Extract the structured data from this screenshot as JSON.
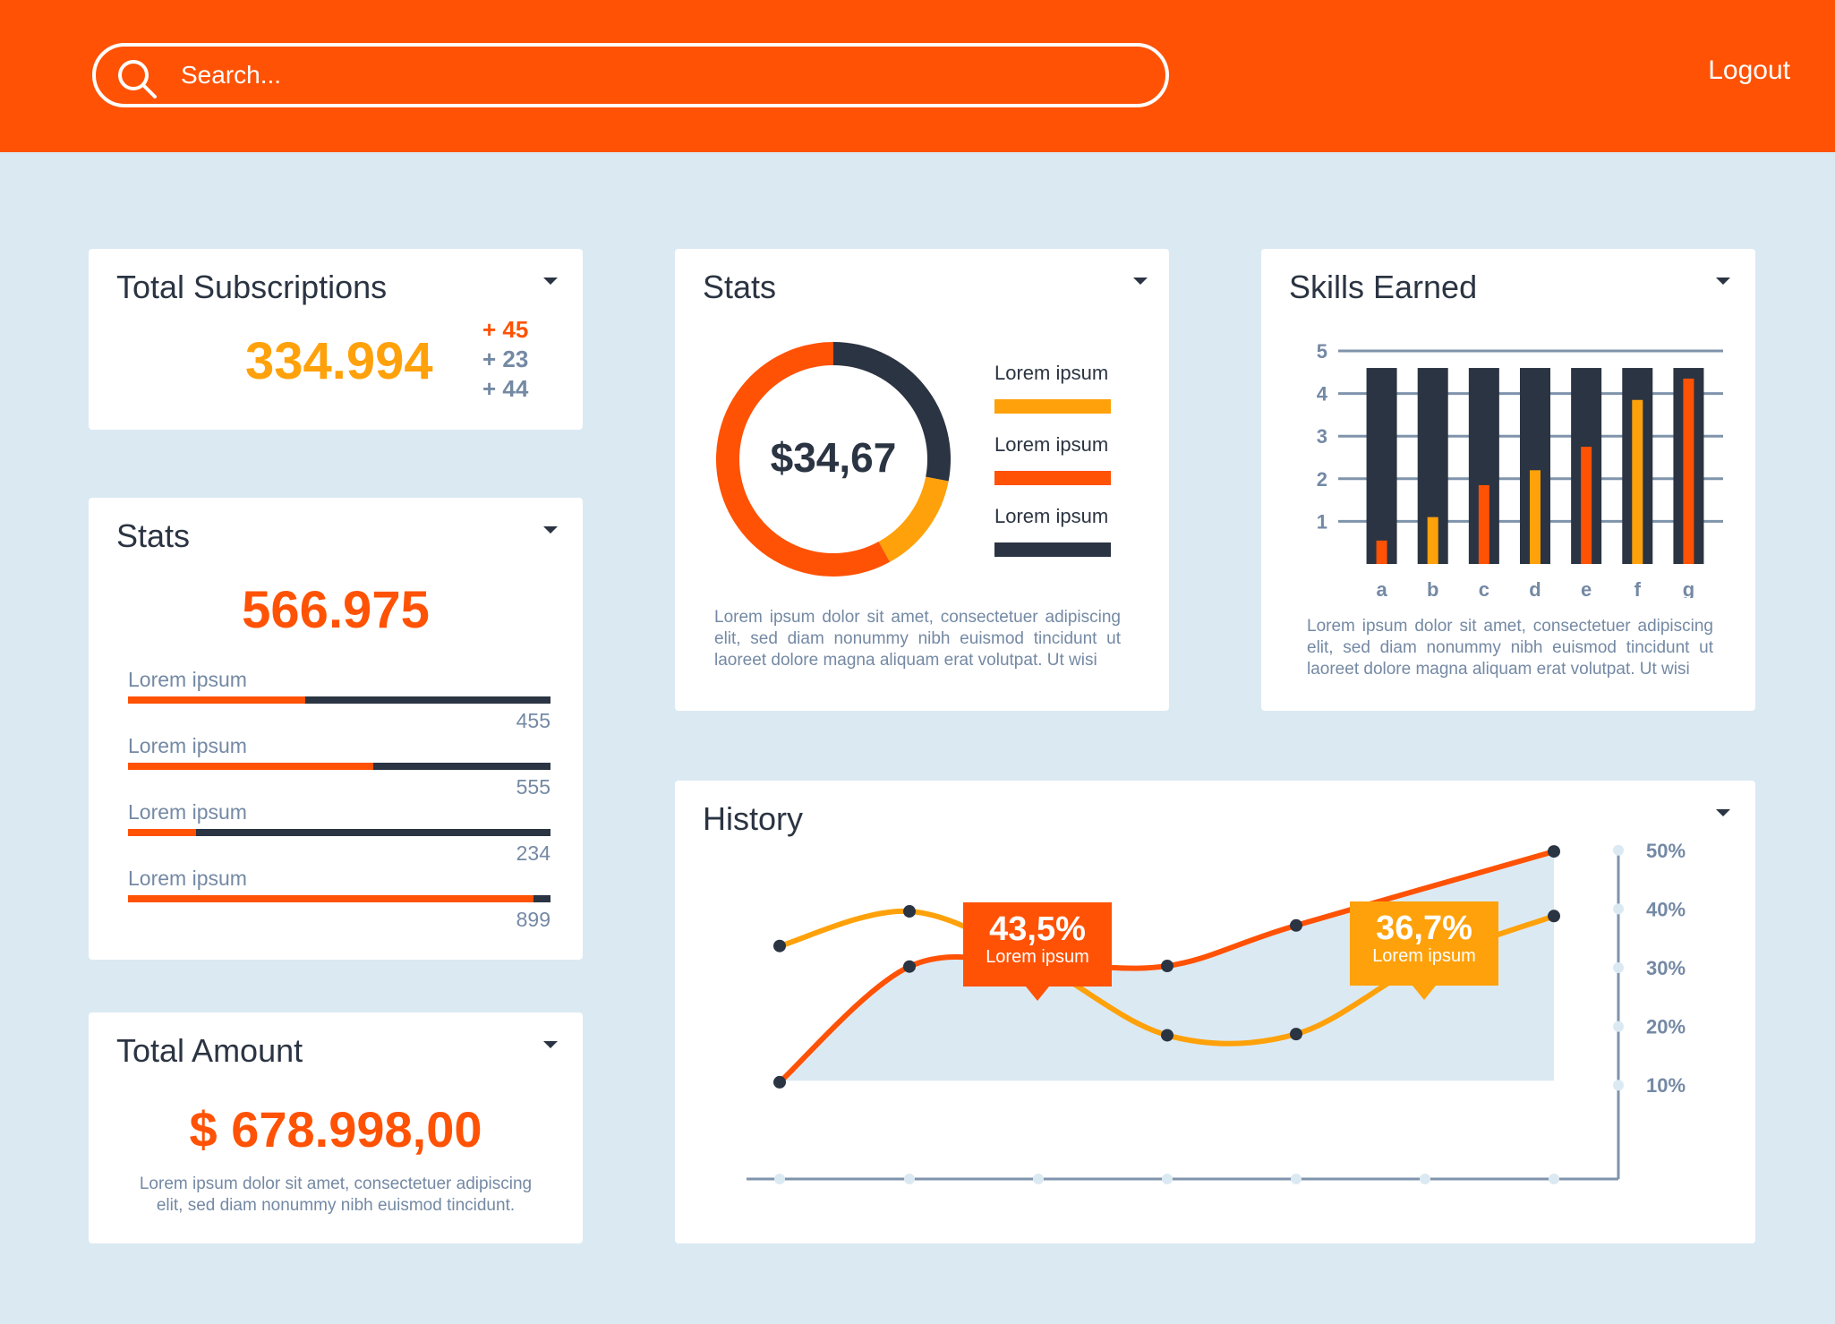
{
  "header": {
    "search_placeholder": "Search...",
    "logout_label": "Logout"
  },
  "colors": {
    "orange": "#ff5205",
    "amber": "#ffa10a",
    "navy": "#2b3442",
    "muted": "#7489a4",
    "background": "#dbe9f2"
  },
  "subscriptions": {
    "title": "Total Subscriptions",
    "value": "334.994",
    "deltas": [
      "+ 45",
      "+ 23",
      "+ 44"
    ]
  },
  "stats_progress": {
    "title": "Stats",
    "value": "566.975",
    "items": [
      {
        "label": "Lorem ipsum",
        "value": "455",
        "fill_fraction": 0.42
      },
      {
        "label": "Lorem ipsum",
        "value": "555",
        "fill_fraction": 0.58
      },
      {
        "label": "Lorem ipsum",
        "value": "234",
        "fill_fraction": 0.16
      },
      {
        "label": "Lorem ipsum",
        "value": "899",
        "fill_fraction": 0.96
      }
    ]
  },
  "total_amount": {
    "title": "Total Amount",
    "value": "$ 678.998,00",
    "description": "Lorem ipsum dolor sit amet, consectetuer adipiscing elit, sed diam nonummy nibh euismod tincidunt."
  },
  "donut_stats": {
    "title": "Stats",
    "center_value": "$34,67",
    "legend": [
      {
        "label": "Lorem ipsum",
        "color": "#ffa10a"
      },
      {
        "label": "Lorem ipsum",
        "color": "#ff5205"
      },
      {
        "label": "Lorem ipsum",
        "color": "#2b3442"
      }
    ],
    "description": "Lorem ipsum dolor sit amet, consectetuer adipiscing elit, sed diam nonummy nibh euismod tincidunt ut laoreet dolore magna aliquam erat volutpat. Ut wisi"
  },
  "skills": {
    "title": "Skills Earned",
    "description": "Lorem ipsum dolor sit amet, consectetuer adipiscing elit, sed diam nonummy nibh euismod tincidunt ut laoreet dolore magna aliquam erat volutpat. Ut wisi"
  },
  "history": {
    "title": "History",
    "callouts": [
      {
        "value": "43,5%",
        "label": "Lorem ipsum",
        "color": "#ff5205"
      },
      {
        "value": "36,7%",
        "label": "Lorem ipsum",
        "color": "#ffa10a"
      }
    ]
  },
  "chart_data": [
    {
      "type": "pie",
      "title": "Stats",
      "center_label": "$34,67",
      "slices": [
        {
          "color": "#2b3442",
          "value": 28
        },
        {
          "color": "#ffa10a",
          "value": 14
        },
        {
          "color": "#ff5205",
          "value": 58
        }
      ]
    },
    {
      "type": "bar",
      "title": "Skills Earned",
      "categories": [
        "a",
        "b",
        "c",
        "d",
        "e",
        "f",
        "g"
      ],
      "ylim": [
        0,
        5
      ],
      "yticks": [
        1,
        2,
        3,
        4,
        5
      ],
      "grid": true,
      "series": [
        {
          "color": "#2b3442",
          "values": [
            4.6,
            4.6,
            4.6,
            4.6,
            4.6,
            4.6,
            4.6
          ]
        },
        {
          "color": "#ff5205",
          "values": [
            0.55,
            null,
            1.85,
            null,
            2.75,
            null,
            4.35
          ]
        },
        {
          "color": "#ffa10a",
          "values": [
            null,
            1.1,
            null,
            2.2,
            null,
            3.85,
            null
          ]
        }
      ]
    },
    {
      "type": "line",
      "title": "History",
      "ylim": [
        5,
        55
      ],
      "yticks": [
        "10%",
        "20%",
        "30%",
        "40%",
        "50%"
      ],
      "y_tick_values": [
        10,
        20,
        30,
        40,
        50
      ],
      "x": [
        1,
        2,
        3,
        4,
        5,
        6,
        7
      ],
      "series": [
        {
          "color": "#ff5205",
          "values": [
            10.5,
            30.2,
            30.7,
            30.3,
            37.2,
            null,
            49.8
          ],
          "area": true
        },
        {
          "color": "#ffa10a",
          "values": [
            33.7,
            39.6,
            30.7,
            18.5,
            18.7,
            30.9,
            38.8
          ]
        }
      ]
    }
  ]
}
